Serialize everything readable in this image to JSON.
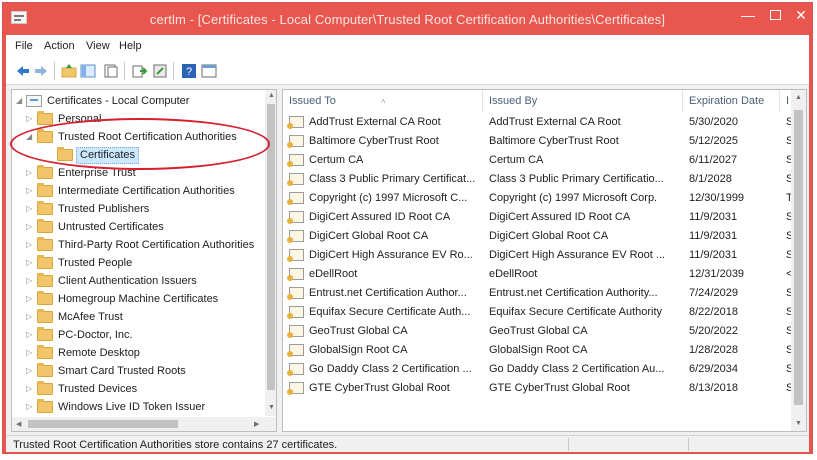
{
  "window": {
    "title": "certlm - [Certificates - Local Computer\\Trusted Root Certification Authorities\\Certificates]",
    "minimize_glyph": "—",
    "close_glyph": "✕"
  },
  "menu": [
    "File",
    "Action",
    "View",
    "Help"
  ],
  "toolbar": {
    "icons": [
      "back-arrow-icon",
      "forward-arrow-icon",
      "folder-up-icon",
      "show-hide-tree-icon",
      "copy-icon",
      "export-list-icon",
      "properties-icon",
      "help-icon",
      "console-view-icon"
    ]
  },
  "tree": {
    "root": "Certificates - Local Computer",
    "items": [
      {
        "label": "Personal",
        "expanded": false
      },
      {
        "label": "Trusted Root Certification Authorities",
        "expanded": true
      },
      {
        "label": "Certificates",
        "selected": true
      },
      {
        "label": "Enterprise Trust",
        "expanded": false
      },
      {
        "label": "Intermediate Certification Authorities",
        "expanded": false
      },
      {
        "label": "Trusted Publishers",
        "expanded": false
      },
      {
        "label": "Untrusted Certificates",
        "expanded": false
      },
      {
        "label": "Third-Party Root Certification Authorities",
        "expanded": false
      },
      {
        "label": "Trusted People",
        "expanded": false
      },
      {
        "label": "Client Authentication Issuers",
        "expanded": false
      },
      {
        "label": "Homegroup Machine Certificates",
        "expanded": false
      },
      {
        "label": "McAfee Trust",
        "expanded": false
      },
      {
        "label": "PC-Doctor, Inc.",
        "expanded": false
      },
      {
        "label": "Remote Desktop",
        "expanded": false
      },
      {
        "label": "Smart Card Trusted Roots",
        "expanded": false
      },
      {
        "label": "Trusted Devices",
        "expanded": false
      },
      {
        "label": "Windows Live ID Token Issuer",
        "expanded": false
      }
    ]
  },
  "list": {
    "columns": [
      "Issued To",
      "Issued By",
      "Expiration Date",
      "I"
    ],
    "rows": [
      {
        "issued_to": "AddTrust External CA Root",
        "issued_by": "AddTrust External CA Root",
        "expiration": "5/30/2020",
        "extra": "S"
      },
      {
        "issued_to": "Baltimore CyberTrust Root",
        "issued_by": "Baltimore CyberTrust Root",
        "expiration": "5/12/2025",
        "extra": "S"
      },
      {
        "issued_to": "Certum CA",
        "issued_by": "Certum CA",
        "expiration": "6/11/2027",
        "extra": "S"
      },
      {
        "issued_to": "Class 3 Public Primary Certificat...",
        "issued_by": "Class 3 Public Primary Certificatio...",
        "expiration": "8/1/2028",
        "extra": "S"
      },
      {
        "issued_to": "Copyright (c) 1997 Microsoft C...",
        "issued_by": "Copyright (c) 1997 Microsoft Corp.",
        "expiration": "12/30/1999",
        "extra": "T"
      },
      {
        "issued_to": "DigiCert Assured ID Root CA",
        "issued_by": "DigiCert Assured ID Root CA",
        "expiration": "11/9/2031",
        "extra": "S"
      },
      {
        "issued_to": "DigiCert Global Root CA",
        "issued_by": "DigiCert Global Root CA",
        "expiration": "11/9/2031",
        "extra": "S"
      },
      {
        "issued_to": "DigiCert High Assurance EV Ro...",
        "issued_by": "DigiCert High Assurance EV Root ...",
        "expiration": "11/9/2031",
        "extra": "S"
      },
      {
        "issued_to": "eDellRoot",
        "issued_by": "eDellRoot",
        "expiration": "12/31/2039",
        "extra": "<"
      },
      {
        "issued_to": "Entrust.net Certification Author...",
        "issued_by": "Entrust.net Certification Authority...",
        "expiration": "7/24/2029",
        "extra": "S"
      },
      {
        "issued_to": "Equifax Secure Certificate Auth...",
        "issued_by": "Equifax Secure Certificate Authority",
        "expiration": "8/22/2018",
        "extra": "S"
      },
      {
        "issued_to": "GeoTrust Global CA",
        "issued_by": "GeoTrust Global CA",
        "expiration": "5/20/2022",
        "extra": "S"
      },
      {
        "issued_to": "GlobalSign Root CA",
        "issued_by": "GlobalSign Root CA",
        "expiration": "1/28/2028",
        "extra": "S"
      },
      {
        "issued_to": "Go Daddy Class 2 Certification ...",
        "issued_by": "Go Daddy Class 2 Certification Au...",
        "expiration": "6/29/2034",
        "extra": "S"
      },
      {
        "issued_to": "GTE CyberTrust Global Root",
        "issued_by": "GTE CyberTrust Global Root",
        "expiration": "8/13/2018",
        "extra": "S"
      }
    ]
  },
  "status": "Trusted Root Certification Authorities store contains 27 certificates.",
  "colors": {
    "titlebar": "#e8564e",
    "annotation_circle": "#d62030",
    "selection": "#cce8ff"
  }
}
